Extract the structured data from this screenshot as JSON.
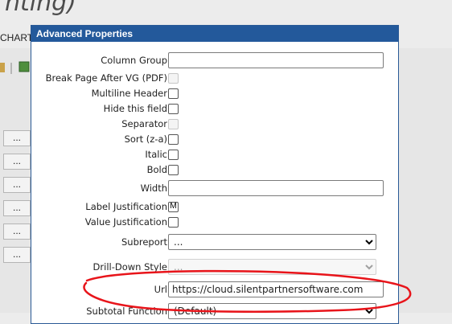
{
  "background": {
    "title_fragment": "nting)",
    "chart_fragment": "CHART",
    "ellipsis_buttons": [
      "...",
      "...",
      "...",
      "...",
      "...",
      "..."
    ]
  },
  "dialog": {
    "title": "Advanced Properties",
    "fields": {
      "column_group": {
        "label": "Column Group",
        "value": ""
      },
      "break_page": {
        "label": "Break Page After VG (PDF)",
        "checked": false,
        "disabled": true
      },
      "multiline_header": {
        "label": "Multiline Header",
        "checked": false
      },
      "hide_field": {
        "label": "Hide this field",
        "checked": false
      },
      "separator": {
        "label": "Separator",
        "checked": false,
        "disabled": true
      },
      "sort": {
        "label": "Sort (z-a)",
        "checked": false
      },
      "italic": {
        "label": "Italic",
        "checked": false
      },
      "bold": {
        "label": "Bold",
        "checked": false
      },
      "width": {
        "label": "Width",
        "value": ""
      },
      "label_justification": {
        "label": "Label Justification",
        "value": "M"
      },
      "value_justification": {
        "label": "Value Justification",
        "checked": false
      },
      "subreport": {
        "label": "Subreport",
        "selected": "..."
      },
      "drill_down_style": {
        "label": "Drill-Down Style",
        "selected": "...",
        "disabled": true
      },
      "url": {
        "label": "Url",
        "value": "https://cloud.silentpartnersoftware.com"
      },
      "subtotal_function": {
        "label": "Subtotal Function",
        "selected": "(Default)"
      }
    }
  },
  "annotation": {
    "color": "#e8141a"
  },
  "colors": {
    "titlebar": "#23599b"
  }
}
